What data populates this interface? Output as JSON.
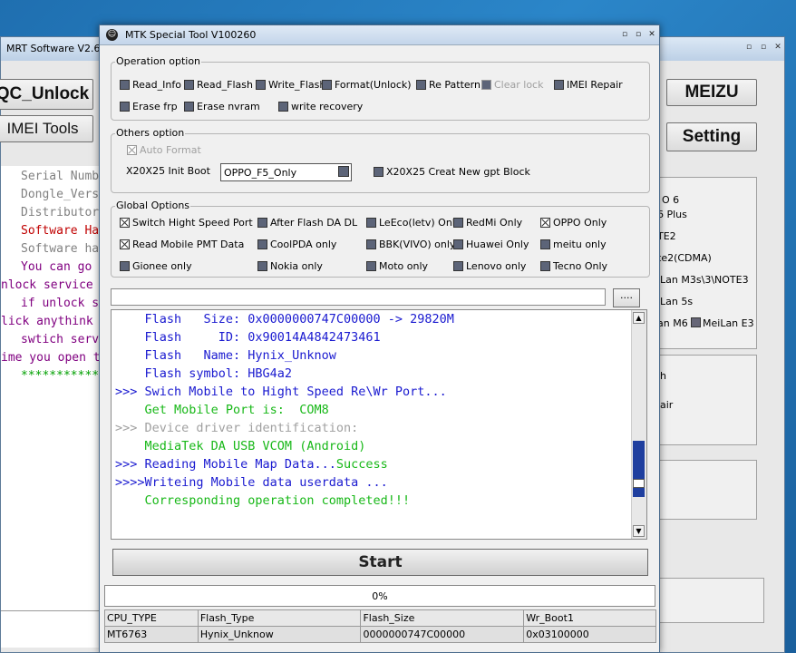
{
  "bg_window": {
    "title": "MRT Software V2.60",
    "btn_qc_unlock": "QC_Unlock",
    "btn_imei_tools": "IMEI Tools",
    "btn_meizu": "MEIZU",
    "btn_setting": "Setting",
    "log_lines": [
      {
        "text": "Serial Numb",
        "color": "#808080"
      },
      {
        "text": "Dongle_Vers",
        "color": "#808080"
      },
      {
        "text": "Distributor",
        "color": "#808080"
      },
      {
        "text": "Software Ha",
        "color": "#c00000"
      },
      {
        "text": "Software ha",
        "color": "#808080"
      },
      {
        "text": "You can go ",
        "color": "#800080"
      },
      {
        "text": "nlock service",
        "color": "#800080"
      },
      {
        "text": "if unlock s",
        "color": "#800080"
      },
      {
        "text": "lick anythink",
        "color": "#800080"
      },
      {
        "text": "swtich serv",
        "color": "#800080"
      },
      {
        "text": "ime you open t",
        "color": "#800080"
      },
      {
        "text": "***********",
        "color": "#00a000"
      }
    ],
    "right_items_top": [
      "O 6",
      "6 Plus",
      "TE2",
      "te2(CDMA)",
      "iLan M3s\\3\\NOTE3",
      "iLan 5s"
    ],
    "right_item_meilan_m6": "an M6",
    "right_item_meilan_e3": "MeiLan E3",
    "right_items_mid": [
      "h",
      "air"
    ]
  },
  "window": {
    "title": "MTK Special Tool V100260"
  },
  "operation": {
    "legend": "Operation option",
    "items": [
      "Read_Info",
      "Read_Flash",
      "Write_Flash",
      "Format(Unlock)",
      "Re Pattern l",
      "Clear lock",
      "IMEI Repair",
      "Erase frp",
      "Erase nvram",
      "write recovery"
    ]
  },
  "others": {
    "legend": "Others option",
    "auto_format": "Auto Format",
    "init_boot_label": "X20X25 Init Boot",
    "init_boot_value": "OPPO_F5_Only",
    "gpt_label": "X20X25 Creat New gpt Block"
  },
  "global": {
    "legend": "Global Options",
    "items": [
      "Switch Hight Speed Port",
      "After Flash DA DL",
      "LeEco(letv) Only",
      "RedMi Only",
      "OPPO Only",
      "Read Mobile PMT Data",
      "CoolPDA only",
      "BBK(VIVO) only",
      "Huawei Only",
      "meitu only",
      "Gionee only",
      "Nokia only",
      "Moto only",
      "Lenovo only",
      "Tecno Only"
    ]
  },
  "browse_label": "....",
  "log": [
    {
      "text": "    Flash   Size: 0x0000000747C00000 -> 29820M",
      "color": "#1a1ad0"
    },
    {
      "text": "    Flash     ID: 0x90014A4842473461",
      "color": "#1a1ad0"
    },
    {
      "text": "    Flash   Name: Hynix_Unknow",
      "color": "#1a1ad0"
    },
    {
      "text": "    Flash symbol: HBG4a2",
      "color": "#1a1ad0"
    },
    {
      "text": ">>> Swich Mobile to Hight Speed Re\\Wr Port...",
      "color": "#1a1ad0"
    },
    {
      "text": "    Get Mobile Port is:  COM8",
      "color": "#18b818"
    },
    {
      "text": ">>> Device driver identification:",
      "color": "#a0a0a0"
    },
    {
      "text": "    MediaTek DA USB VCOM (Android)",
      "color": "#18b818"
    },
    {
      "text": ">>> Reading Mobile Map Data...",
      "color": "#1a1ad0",
      "suffix": "Success",
      "suffix_color": "#18b818"
    },
    {
      "text": ">>>>Writeing Mobile data userdata ...",
      "color": "#1a1ad0"
    },
    {
      "text": "    Corresponding operation completed!!!",
      "color": "#18b818"
    }
  ],
  "start_label": "Start",
  "progress": {
    "percent": 0,
    "label": "0%"
  },
  "info_table": {
    "headers": [
      "CPU_TYPE",
      "Flash_Type",
      "Flash_Size",
      "Wr_Boot1"
    ],
    "values": [
      "MT6763",
      "Hynix_Unknow",
      "0000000747C00000",
      "0x03100000"
    ]
  },
  "colors": {
    "checkbox_fill": "#5c6478",
    "log_blue": "#1a1ad0",
    "log_green": "#18b818",
    "scroll_thumb": "#1f3f9f"
  }
}
